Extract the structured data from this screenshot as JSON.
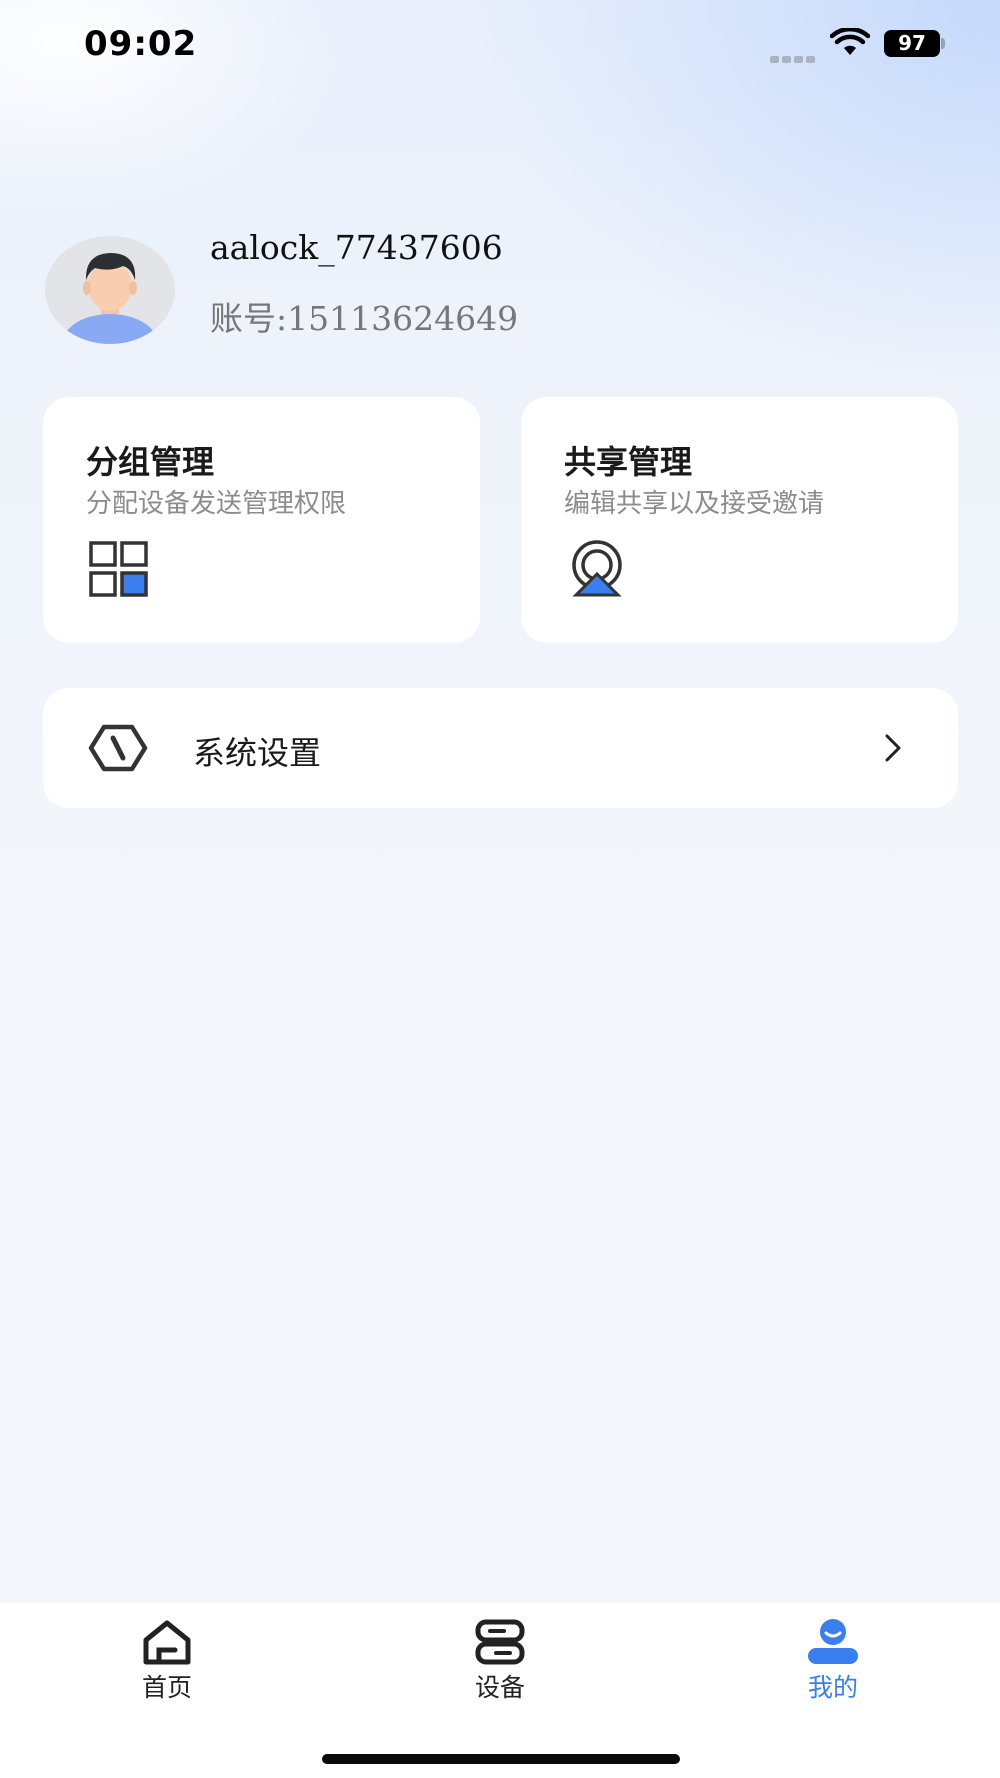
{
  "status_bar": {
    "time": "09:02",
    "battery": "97"
  },
  "profile": {
    "username": "aalock_77437606",
    "account": "账号:15113624649"
  },
  "cards": [
    {
      "title": "分组管理",
      "subtitle": "分配设备发送管理权限",
      "icon": "group-grid-icon"
    },
    {
      "title": "共享管理",
      "subtitle": "编辑共享以及接受邀请",
      "icon": "share-icon"
    }
  ],
  "settings": {
    "label": "系统设置",
    "icon": "settings-hexagon-icon"
  },
  "tab_bar": {
    "tabs": [
      {
        "label": "首页",
        "icon": "home-icon",
        "active": false
      },
      {
        "label": "设备",
        "icon": "device-icon",
        "active": false
      },
      {
        "label": "我的",
        "icon": "profile-icon",
        "active": true
      }
    ]
  },
  "colors": {
    "accent": "#3b7ef0",
    "background": "#f3f6fb",
    "card": "#ffffff"
  }
}
